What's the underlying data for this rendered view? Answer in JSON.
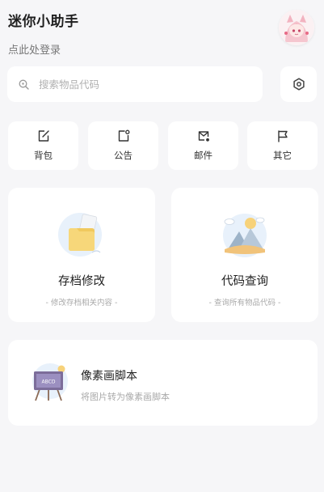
{
  "header": {
    "title": "迷你小助手",
    "login_text": "点此处登录"
  },
  "search": {
    "placeholder": "搜索物品代码",
    "value": ""
  },
  "quick_actions": [
    {
      "label": "背包",
      "icon": "edit-square-icon"
    },
    {
      "label": "公告",
      "icon": "notice-square-icon"
    },
    {
      "label": "邮件",
      "icon": "mail-icon"
    },
    {
      "label": "其它",
      "icon": "flag-icon"
    }
  ],
  "feature_cards": [
    {
      "title": "存档修改",
      "subtitle": "- 修改存档相关内容 -",
      "icon": "folder-illustration"
    },
    {
      "title": "代码查询",
      "subtitle": "- 查询所有物品代码 -",
      "icon": "mountain-illustration"
    }
  ],
  "wide_card": {
    "title": "像素画脚本",
    "subtitle": "将图片转为像素画脚本",
    "easel_text": "ABCD",
    "icon": "easel-illustration"
  },
  "colors": {
    "background": "#f6f6f8",
    "card": "#ffffff",
    "folder": "#f7d77a",
    "muted": "#aaaaaa"
  }
}
